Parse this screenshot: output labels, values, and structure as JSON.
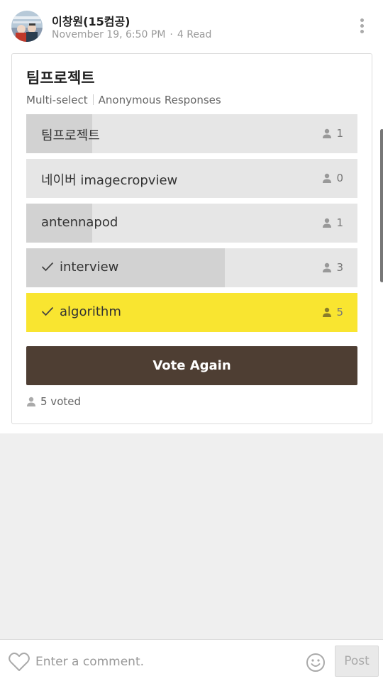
{
  "post": {
    "author": "이창원(15컴공)",
    "timestamp": "November 19, 6:50 PM",
    "read_count": "4 Read",
    "more_icon": "more-vertical-icon"
  },
  "poll": {
    "title": "팀프로젝트",
    "type_label": "Multi-select",
    "anonymity_label": "Anonymous Responses",
    "options": [
      {
        "label": "팀프로젝트",
        "count": "1",
        "share": 0.2,
        "checked": false,
        "selected": false
      },
      {
        "label": "네이버 imagecropview",
        "count": "0",
        "share": 0.0,
        "checked": false,
        "selected": false
      },
      {
        "label": "antennapod",
        "count": "1",
        "share": 0.2,
        "checked": false,
        "selected": false
      },
      {
        "label": "interview",
        "count": "3",
        "share": 0.6,
        "checked": true,
        "selected": false
      },
      {
        "label": "algorithm",
        "count": "5",
        "share": 1.0,
        "checked": true,
        "selected": true
      }
    ],
    "vote_button": "Vote Again",
    "voted_summary": "5 voted"
  },
  "comment_bar": {
    "placeholder": "Enter a comment.",
    "post_label": "Post",
    "like_icon": "heart-outline-icon",
    "emoji_icon": "smiley-icon"
  },
  "colors": {
    "selected_option": "#f9e530",
    "vote_button": "#4e3e33",
    "option_bg": "#e6e6e6",
    "option_fill": "#d2d2d2"
  }
}
